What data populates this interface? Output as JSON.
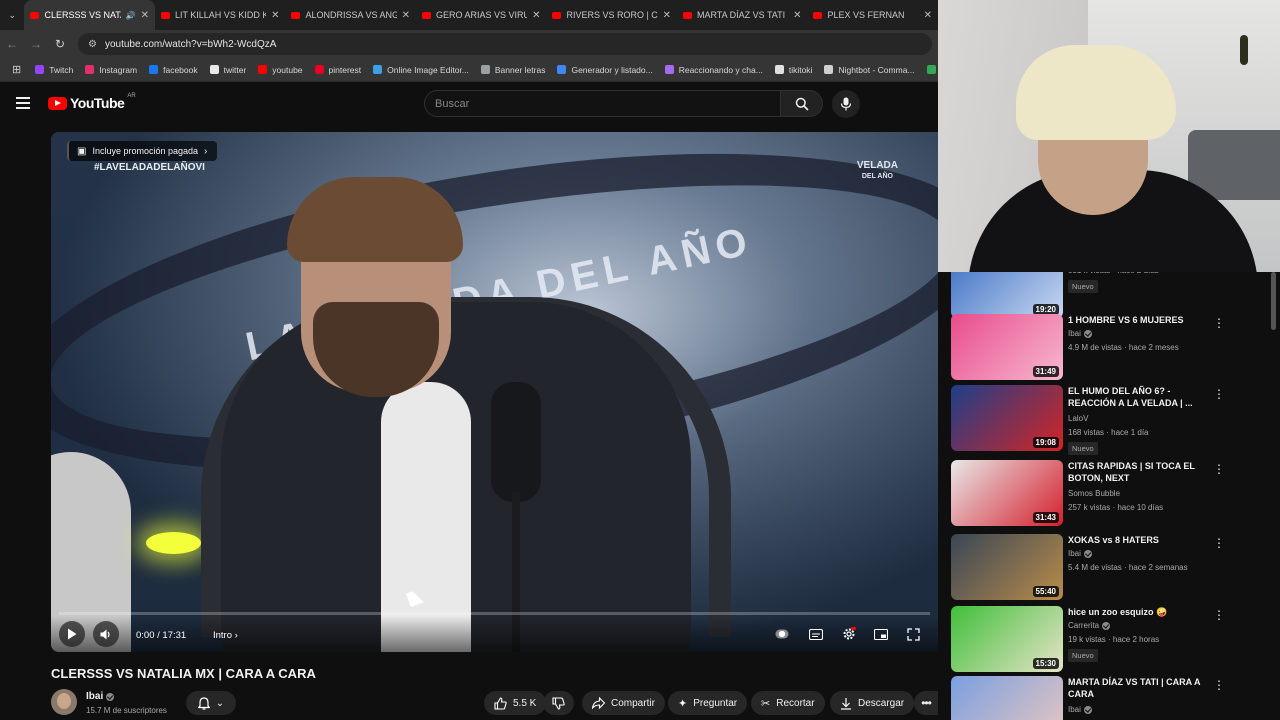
{
  "browser": {
    "tabs": [
      {
        "label": "CLERSSS VS NATALIA",
        "active": true,
        "audio": true
      },
      {
        "label": "LIT KILLAH VS KIDD KEO"
      },
      {
        "label": "ALONDRISSA VS ANGIE V"
      },
      {
        "label": "GERO ARIAS VS VIRUZZ"
      },
      {
        "label": "RIVERS VS RORO | CARA"
      },
      {
        "label": "MARTA DÍAZ VS TATI | CA"
      },
      {
        "label": "PLEX VS FERNAN"
      }
    ],
    "url": "youtube.com/watch?v=bWh2-WcdQzA",
    "bookmarks": [
      {
        "label": "Twitch",
        "color": "#9146ff"
      },
      {
        "label": "Instagram",
        "color": "#e1306c"
      },
      {
        "label": "facebook",
        "color": "#1877f2"
      },
      {
        "label": "twitter",
        "color": "#e7e9ea"
      },
      {
        "label": "youtube",
        "color": "#ff0000"
      },
      {
        "label": "pinterest",
        "color": "#e60023"
      },
      {
        "label": "Online Image Editor...",
        "color": "#3ca0e6"
      },
      {
        "label": "Banner letras",
        "color": "#9aa0a6"
      },
      {
        "label": "Generador y listado...",
        "color": "#4285f4"
      },
      {
        "label": "Reaccionando y cha...",
        "color": "#a56cf0"
      },
      {
        "label": "tikitoki",
        "color": "#e0e0e0"
      },
      {
        "label": "Nightbot - Comma...",
        "color": "#cfcfcf"
      },
      {
        "label": "Fútbol p",
        "color": "#34a853"
      }
    ]
  },
  "youtube": {
    "logo_text": "YouTube",
    "country_code": "AR",
    "search_placeholder": "Buscar"
  },
  "player": {
    "promo_label": "Incluye promoción pagada",
    "hashtag": "#LAVELADADELAÑOVI",
    "overlay_logo_line1": "VELADA",
    "overlay_logo_line2": "DEL AÑO",
    "ring_text": "LA VELADA DEL AÑO",
    "time": "0:00 / 17:31",
    "chapter": "Intro",
    "progress": 0.0
  },
  "video": {
    "title": "CLERSSS VS NATALIA MX | CARA A CARA",
    "channel": "Ibai",
    "subscribers": "15.7 M de suscriptores",
    "likes": "5.5 K",
    "share": "Compartir",
    "ask": "Preguntar",
    "clip": "Recortar",
    "download": "Descargar"
  },
  "recommendations": [
    {
      "title": "",
      "channel": "Ibai",
      "verified": true,
      "meta": "831 k vistas · hace 2 días",
      "badge": "Nuevo",
      "duration": "19:20",
      "thumb_colors": [
        "#3b6fc4",
        "#c9d8f0"
      ]
    },
    {
      "title": "1 HOMBRE VS 6 MUJERES",
      "channel": "Ibai",
      "verified": true,
      "meta": "4.9 M de vistas · hace 2 meses",
      "badge": "",
      "duration": "31:49",
      "thumb_colors": [
        "#e84c8c",
        "#f7b8d0"
      ]
    },
    {
      "title": "EL HUMO DEL AÑO 6? - REACCIÓN A LA VELADA | ...",
      "channel": "LaloV",
      "verified": false,
      "meta": "168 vistas · hace 1 día",
      "badge": "Nuevo",
      "duration": "19:08",
      "thumb_colors": [
        "#1d3f8a",
        "#d42424"
      ]
    },
    {
      "title": "CITAS RAPIDAS | SI TOCA EL BOTON, NEXT",
      "channel": "Somos Bubble",
      "verified": false,
      "meta": "257 k vistas · hace 10 días",
      "badge": "",
      "duration": "31:43",
      "thumb_colors": [
        "#e8e8e8",
        "#d41f2c"
      ]
    },
    {
      "title": "XOKAS vs 8 HATERS",
      "channel": "Ibai",
      "verified": true,
      "meta": "5.4 M de vistas · hace 2 semanas",
      "badge": "",
      "duration": "55:40",
      "thumb_colors": [
        "#3a4656",
        "#b98c4a"
      ]
    },
    {
      "title": "hice un zoo esquizo 🤪",
      "channel": "Carrerita",
      "verified": true,
      "meta": "19 k vistas · hace 2 horas",
      "badge": "Nuevo",
      "duration": "15:30",
      "thumb_colors": [
        "#3fbf3a",
        "#e8e3c8"
      ]
    },
    {
      "title": "MARTA DÍAZ VS TATI | CARA A CARA",
      "channel": "Ibai",
      "verified": true,
      "meta": "",
      "badge": "",
      "duration": "",
      "thumb_colors": [
        "#7a9fe0",
        "#e9c7c0"
      ]
    }
  ]
}
